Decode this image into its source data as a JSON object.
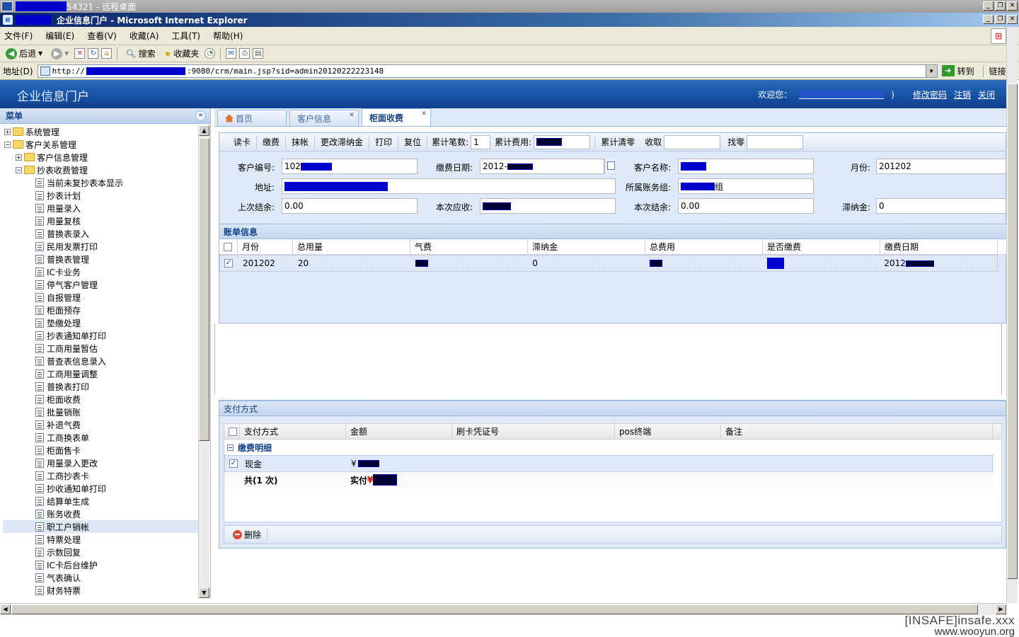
{
  "remote_desktop": {
    "title_suffix": "54321 - 远程桌面"
  },
  "ie": {
    "title": "企业信息门户 - Microsoft Internet Explorer",
    "menu": [
      "文件(F)",
      "编辑(E)",
      "查看(V)",
      "收藏(A)",
      "工具(T)",
      "帮助(H)"
    ],
    "toolbar": {
      "back": "后退",
      "search": "搜索",
      "favorites": "收藏夹"
    },
    "address_label": "地址(D)",
    "url_prefix": "http://",
    "url_suffix": ":9080/crm/main.jsp?sid=admin20120222223148",
    "go": "转到",
    "links": "链接"
  },
  "app": {
    "title": "企业信息门户",
    "welcome": "欢迎您：",
    "change_password": "修改密码",
    "logout": "注销",
    "close": "关闭"
  },
  "menu_panel": {
    "title": "菜单",
    "tree": [
      {
        "label": "系统管理",
        "level": 0,
        "type": "folder",
        "expanded": false
      },
      {
        "label": "客户关系管理",
        "level": 0,
        "type": "folder",
        "expanded": true
      },
      {
        "label": "客户信息管理",
        "level": 1,
        "type": "folder",
        "expanded": false
      },
      {
        "label": "抄表收费管理",
        "level": 1,
        "type": "folder",
        "expanded": true
      },
      {
        "label": "当前未复抄表本显示",
        "level": 2,
        "type": "leaf"
      },
      {
        "label": "抄表计划",
        "level": 2,
        "type": "leaf"
      },
      {
        "label": "用量录入",
        "level": 2,
        "type": "leaf"
      },
      {
        "label": "用量复核",
        "level": 2,
        "type": "leaf"
      },
      {
        "label": "普换表录入",
        "level": 2,
        "type": "leaf"
      },
      {
        "label": "民用发票打印",
        "level": 2,
        "type": "leaf"
      },
      {
        "label": "普换表管理",
        "level": 2,
        "type": "leaf"
      },
      {
        "label": "IC卡业务",
        "level": 2,
        "type": "leaf"
      },
      {
        "label": "停气客户管理",
        "level": 2,
        "type": "leaf"
      },
      {
        "label": "自报管理",
        "level": 2,
        "type": "leaf"
      },
      {
        "label": "柜面预存",
        "level": 2,
        "type": "leaf"
      },
      {
        "label": "垫缴处理",
        "level": 2,
        "type": "leaf"
      },
      {
        "label": "抄表通知单打印",
        "level": 2,
        "type": "leaf"
      },
      {
        "label": "工商用量暂估",
        "level": 2,
        "type": "leaf"
      },
      {
        "label": "普查表信息录入",
        "level": 2,
        "type": "leaf"
      },
      {
        "label": "工商用量调整",
        "level": 2,
        "type": "leaf"
      },
      {
        "label": "普换表打印",
        "level": 2,
        "type": "leaf"
      },
      {
        "label": "柜面收费",
        "level": 2,
        "type": "leaf"
      },
      {
        "label": "批量销账",
        "level": 2,
        "type": "leaf"
      },
      {
        "label": "补退气费",
        "level": 2,
        "type": "leaf"
      },
      {
        "label": "工商换表单",
        "level": 2,
        "type": "leaf"
      },
      {
        "label": "柜面售卡",
        "level": 2,
        "type": "leaf"
      },
      {
        "label": "用量录入更改",
        "level": 2,
        "type": "leaf"
      },
      {
        "label": "工商抄表卡",
        "level": 2,
        "type": "leaf"
      },
      {
        "label": "抄收通知单打印",
        "level": 2,
        "type": "leaf"
      },
      {
        "label": "结算单生成",
        "level": 2,
        "type": "leaf"
      },
      {
        "label": "账务收费",
        "level": 2,
        "type": "leaf"
      },
      {
        "label": "职工户销帐",
        "level": 2,
        "type": "leaf",
        "selected": true
      },
      {
        "label": "特票处理",
        "level": 2,
        "type": "leaf"
      },
      {
        "label": "示数回复",
        "level": 2,
        "type": "leaf"
      },
      {
        "label": "IC卡后台维护",
        "level": 2,
        "type": "leaf"
      },
      {
        "label": "气表确认",
        "level": 2,
        "type": "leaf"
      },
      {
        "label": "财务特票",
        "level": 2,
        "type": "leaf"
      }
    ]
  },
  "tabs": [
    {
      "label": "首页",
      "active": false,
      "closable": false
    },
    {
      "label": "客户信息",
      "active": false,
      "closable": true
    },
    {
      "label": "柜面收费",
      "active": true,
      "closable": true
    }
  ],
  "actions": [
    "读卡",
    "缴费",
    "抹帐",
    "更改滞纳金",
    "打印",
    "复位"
  ],
  "counters": {
    "count_label": "累计笔数:",
    "count_value": "1",
    "fee_label": "累计费用:",
    "clear_label": "累计清零",
    "receive_label": "收取",
    "change_label": "找零"
  },
  "form": {
    "customer_no_label": "客户编号:",
    "customer_no_value": "102",
    "pay_date_label": "缴费日期:",
    "pay_date_value": "2012-",
    "customer_name_label": "客户名称:",
    "month_label": "月份:",
    "month_value": "201202",
    "address_label": "地址:",
    "account_group_label": "所属账务组:",
    "account_group_suffix": "组",
    "last_balance_label": "上次结余:",
    "last_balance_value": "0.00",
    "current_due_label": "本次应收:",
    "current_balance_label": "本次结余:",
    "current_balance_value": "0.00",
    "late_fee_label": "滞纳金:",
    "late_fee_value": "0"
  },
  "bill": {
    "title": "账单信息",
    "columns": [
      "月份",
      "总用量",
      "气费",
      "滞纳金",
      "总费用",
      "是否缴费",
      "缴费日期"
    ],
    "rows": [
      {
        "checked": true,
        "month": "201202",
        "usage": "20",
        "gas_fee": "",
        "late_fee": "0",
        "total": "",
        "paid": "",
        "pay_date": "2012"
      }
    ]
  },
  "payment": {
    "title": "支付方式",
    "columns": [
      "支付方式",
      "金额",
      "刷卡凭证号",
      "pos终端",
      "备注"
    ],
    "group_title": "缴费明细",
    "rows": [
      {
        "checked": true,
        "method": "现金",
        "amount_prefix": "¥"
      }
    ],
    "summary_count": "共(1 次)",
    "summary_paid_label": "实付",
    "summary_currency": "¥",
    "delete_label": "删除"
  },
  "watermark": {
    "line1": "[INSAFE]insafe.xxx",
    "line2": "www.wooyun.org"
  }
}
